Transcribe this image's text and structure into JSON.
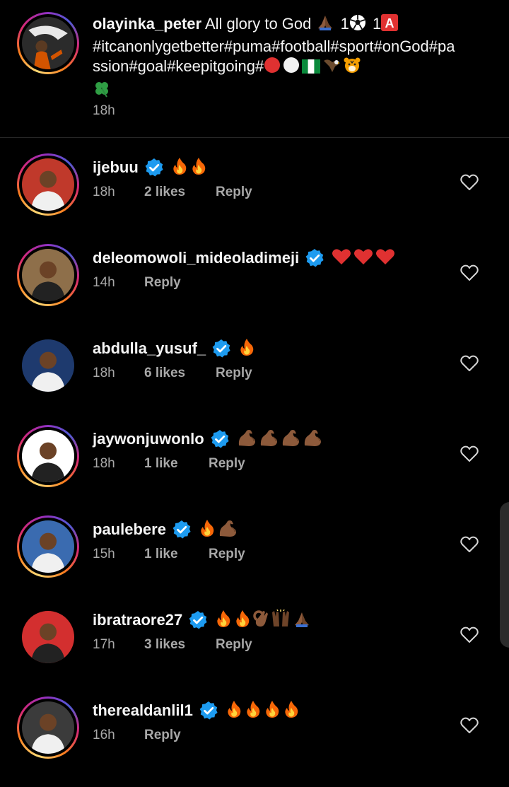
{
  "caption": {
    "username": "olayinka_peter",
    "text_part1": "All glory to God",
    "text_part2": "1",
    "text_part3": "1",
    "hashtags": "#itcanonlygetbetter#puma#football#sport#onGod#passion#goal#keepitgoing#",
    "time": "18h"
  },
  "comments": [
    {
      "username": "ijebuu",
      "emojis": [
        "fire",
        "fire"
      ],
      "time": "18h",
      "likes": "2 likes",
      "reply": "Reply",
      "ring": true,
      "avatar_color": "#c0392b"
    },
    {
      "username": "deleomowoli_mideoladimeji",
      "emojis": [
        "red-heart",
        "red-heart",
        "red-heart"
      ],
      "time": "14h",
      "likes": "",
      "reply": "Reply",
      "ring": true,
      "avatar_color": "#8e6f4a"
    },
    {
      "username": "abdulla_yusuf_",
      "emojis": [
        "fire"
      ],
      "time": "18h",
      "likes": "6 likes",
      "reply": "Reply",
      "ring": false,
      "avatar_color": "#1e3a6e"
    },
    {
      "username": "jaywonjuwonlo",
      "emojis": [
        "flexed-biceps",
        "flexed-biceps",
        "flexed-biceps",
        "flexed-biceps"
      ],
      "time": "18h",
      "likes": "1 like",
      "reply": "Reply",
      "ring": true,
      "avatar_color": "#ffffff"
    },
    {
      "username": "paulebere",
      "emojis": [
        "fire",
        "flexed-biceps"
      ],
      "time": "15h",
      "likes": "1 like",
      "reply": "Reply",
      "ring": true,
      "avatar_color": "#3a6bb0"
    },
    {
      "username": "ibratraore27",
      "emojis": [
        "fire",
        "fire",
        "ok-hand",
        "raising-hands",
        "folded-hands"
      ],
      "time": "17h",
      "likes": "3 likes",
      "reply": "Reply",
      "ring": false,
      "avatar_color": "#d32f2f"
    },
    {
      "username": "therealdanlil1",
      "emojis": [
        "fire",
        "fire",
        "fire",
        "fire"
      ],
      "time": "16h",
      "likes": "",
      "reply": "Reply",
      "ring": true,
      "avatar_color": "#3b3b3b"
    }
  ],
  "icons": {
    "verified_color": "#1d9bf0",
    "heart": "heart-outline-icon"
  }
}
